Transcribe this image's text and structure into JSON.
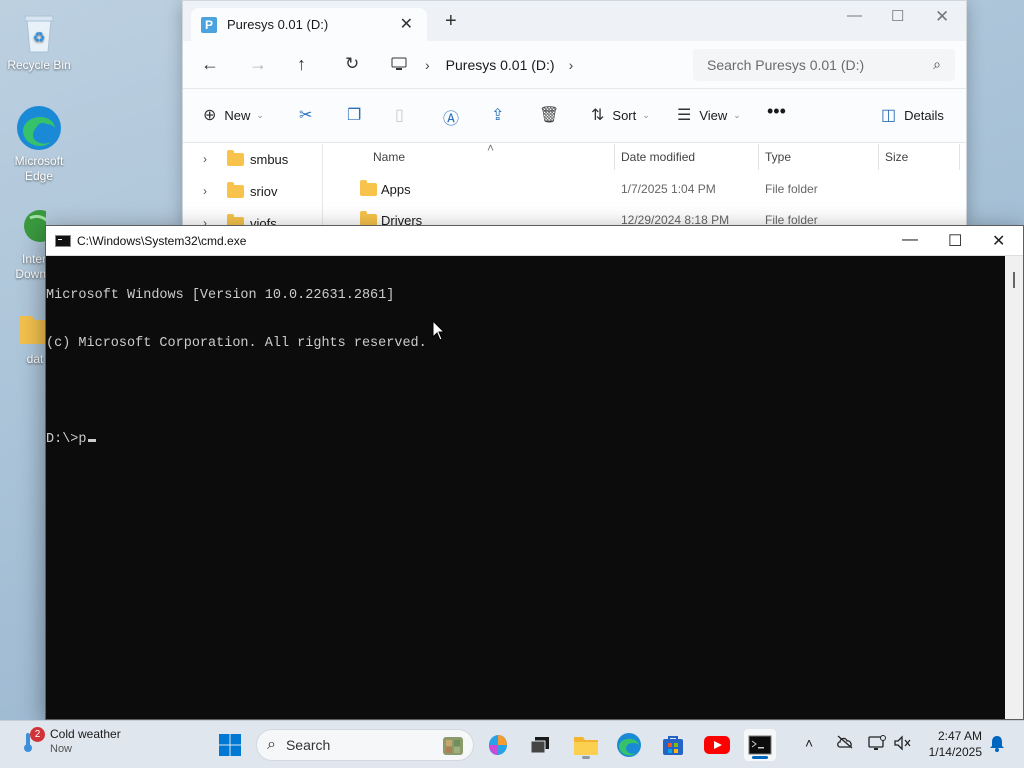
{
  "desktop": {
    "icons": [
      {
        "label": "Recycle Bin"
      },
      {
        "label": "Microsoft Edge"
      },
      {
        "label": "Inter Down"
      },
      {
        "label": "dat"
      }
    ]
  },
  "explorer": {
    "tab_title": "Puresys 0.01 (D:)",
    "breadcrumb": "Puresys 0.01 (D:)",
    "search_placeholder": "Search Puresys 0.01 (D:)",
    "toolbar": {
      "new": "New",
      "sort": "Sort",
      "view": "View",
      "details": "Details"
    },
    "sidebar": [
      "smbus",
      "sriov",
      "viofs"
    ],
    "columns": {
      "name": "Name",
      "date": "Date modified",
      "type": "Type",
      "size": "Size"
    },
    "files": [
      {
        "name": "Apps",
        "date": "1/7/2025 1:04 PM",
        "type": "File folder"
      },
      {
        "name": "Drivers",
        "date": "12/29/2024 8:18 PM",
        "type": "File folder"
      }
    ]
  },
  "cmd": {
    "title": "C:\\Windows\\System32\\cmd.exe",
    "lines": [
      "Microsoft Windows [Version 10.0.22631.2861]",
      "(c) Microsoft Corporation. All rights reserved.",
      "",
      "D:\\>p"
    ]
  },
  "taskbar": {
    "weather_title": "Cold weather",
    "weather_sub": "Now",
    "weather_badge": "2",
    "search_label": "Search",
    "time": "2:47 AM",
    "date": "1/14/2025"
  },
  "colors": {
    "accent": "#0067c0",
    "console_bg": "#0c0c0c",
    "console_fg": "#cccccc"
  }
}
